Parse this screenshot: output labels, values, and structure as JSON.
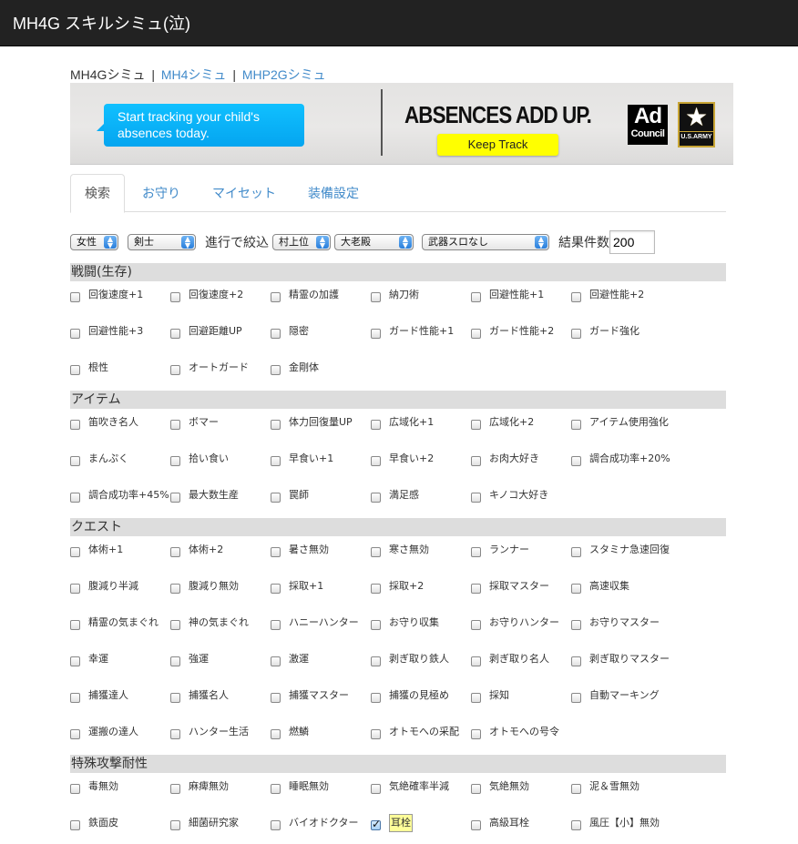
{
  "navbar": {
    "title": "MH4G スキルシミュ(泣)"
  },
  "site_links": {
    "current": "MH4Gシミュ",
    "separator": "|",
    "links": [
      "MH4シミュ",
      "MHP2Gシミュ"
    ]
  },
  "ad": {
    "bubble_text": "Start tracking your child's absences today.",
    "headline": "ABSENCES ADD UP.",
    "cta_label": "Keep Track",
    "logo1_top": "Ad",
    "logo1_bottom": "Council",
    "logo2_icon": "★",
    "logo2_label": "U.S.ARMY",
    "colors": {
      "bubble": "#05a5f0",
      "cta": "#ffff00"
    }
  },
  "tabs": [
    {
      "label": "検索",
      "active": true
    },
    {
      "label": "お守り",
      "active": false
    },
    {
      "label": "マイセット",
      "active": false
    },
    {
      "label": "装備設定",
      "active": false
    }
  ],
  "filters": {
    "gender": "女性",
    "weapon_class": "剣士",
    "progress_label": "進行で絞込",
    "rank": "村上位",
    "progress": "大老殿",
    "weapon_slots": "武器スロなし",
    "result_count_label": "結果件数",
    "result_count": "200"
  },
  "sections": [
    {
      "title": "戦闘(生存)",
      "skills": [
        {
          "label": "回復速度+1",
          "checked": false
        },
        {
          "label": "回復速度+2",
          "checked": false
        },
        {
          "label": "精霊の加護",
          "checked": false
        },
        {
          "label": "納刀術",
          "checked": false
        },
        {
          "label": "回避性能+1",
          "checked": false
        },
        {
          "label": "回避性能+2",
          "checked": false
        },
        {
          "label": "回避性能+3",
          "checked": false
        },
        {
          "label": "回避距離UP",
          "checked": false
        },
        {
          "label": "隠密",
          "checked": false
        },
        {
          "label": "ガード性能+1",
          "checked": false
        },
        {
          "label": "ガード性能+2",
          "checked": false
        },
        {
          "label": "ガード強化",
          "checked": false
        },
        {
          "label": "根性",
          "checked": false
        },
        {
          "label": "オートガード",
          "checked": false
        },
        {
          "label": "金剛体",
          "checked": false
        }
      ]
    },
    {
      "title": "アイテム",
      "skills": [
        {
          "label": "笛吹き名人",
          "checked": false
        },
        {
          "label": "ボマー",
          "checked": false
        },
        {
          "label": "体力回復量UP",
          "checked": false
        },
        {
          "label": "広域化+1",
          "checked": false
        },
        {
          "label": "広域化+2",
          "checked": false
        },
        {
          "label": "アイテム使用強化",
          "checked": false
        },
        {
          "label": "まんぷく",
          "checked": false
        },
        {
          "label": "拾い食い",
          "checked": false
        },
        {
          "label": "早食い+1",
          "checked": false
        },
        {
          "label": "早食い+2",
          "checked": false
        },
        {
          "label": "お肉大好き",
          "checked": false
        },
        {
          "label": "調合成功率+20%",
          "checked": false
        },
        {
          "label": "調合成功率+45%",
          "checked": false
        },
        {
          "label": "最大数生産",
          "checked": false
        },
        {
          "label": "罠師",
          "checked": false
        },
        {
          "label": "満足感",
          "checked": false
        },
        {
          "label": "キノコ大好き",
          "checked": false
        }
      ]
    },
    {
      "title": "クエスト",
      "skills": [
        {
          "label": "体術+1",
          "checked": false
        },
        {
          "label": "体術+2",
          "checked": false
        },
        {
          "label": "暑さ無効",
          "checked": false
        },
        {
          "label": "寒さ無効",
          "checked": false
        },
        {
          "label": "ランナー",
          "checked": false
        },
        {
          "label": "スタミナ急速回復",
          "checked": false
        },
        {
          "label": "腹減り半減",
          "checked": false
        },
        {
          "label": "腹減り無効",
          "checked": false
        },
        {
          "label": "採取+1",
          "checked": false
        },
        {
          "label": "採取+2",
          "checked": false
        },
        {
          "label": "採取マスター",
          "checked": false
        },
        {
          "label": "高速収集",
          "checked": false
        },
        {
          "label": "精霊の気まぐれ",
          "checked": false
        },
        {
          "label": "神の気まぐれ",
          "checked": false
        },
        {
          "label": "ハニーハンター",
          "checked": false
        },
        {
          "label": "お守り収集",
          "checked": false
        },
        {
          "label": "お守りハンター",
          "checked": false
        },
        {
          "label": "お守りマスター",
          "checked": false
        },
        {
          "label": "幸運",
          "checked": false
        },
        {
          "label": "強運",
          "checked": false
        },
        {
          "label": "激運",
          "checked": false
        },
        {
          "label": "剥ぎ取り鉄人",
          "checked": false
        },
        {
          "label": "剥ぎ取り名人",
          "checked": false
        },
        {
          "label": "剥ぎ取りマスター",
          "checked": false
        },
        {
          "label": "捕獲達人",
          "checked": false
        },
        {
          "label": "捕獲名人",
          "checked": false
        },
        {
          "label": "捕獲マスター",
          "checked": false
        },
        {
          "label": "捕獲の見極め",
          "checked": false
        },
        {
          "label": "採知",
          "checked": false
        },
        {
          "label": "自動マーキング",
          "checked": false
        },
        {
          "label": "運搬の達人",
          "checked": false
        },
        {
          "label": "ハンター生活",
          "checked": false
        },
        {
          "label": "燃鱗",
          "checked": false
        },
        {
          "label": "オトモへの采配",
          "checked": false
        },
        {
          "label": "オトモへの号令",
          "checked": false
        }
      ]
    },
    {
      "title": "特殊攻撃耐性",
      "skills": [
        {
          "label": "毒無効",
          "checked": false
        },
        {
          "label": "麻痺無効",
          "checked": false
        },
        {
          "label": "睡眠無効",
          "checked": false
        },
        {
          "label": "気絶確率半減",
          "checked": false
        },
        {
          "label": "気絶無効",
          "checked": false
        },
        {
          "label": "泥＆雪無効",
          "checked": false
        },
        {
          "label": "鉄面皮",
          "checked": false
        },
        {
          "label": "細菌研究家",
          "checked": false
        },
        {
          "label": "バイオドクター",
          "checked": false
        },
        {
          "label": "耳栓",
          "checked": true
        },
        {
          "label": "高級耳栓",
          "checked": false
        },
        {
          "label": "風圧【小】無効",
          "checked": false
        }
      ]
    }
  ]
}
